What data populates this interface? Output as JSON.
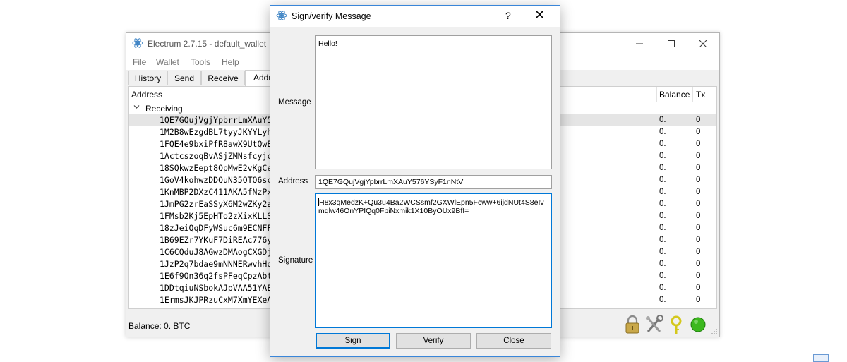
{
  "main_window": {
    "title": "Electrum 2.7.15  -  default_wallet",
    "menu": [
      "File",
      "Wallet",
      "Tools",
      "Help"
    ],
    "tabs": [
      "History",
      "Send",
      "Receive",
      "Addr"
    ],
    "columns": {
      "address": "Address",
      "balance": "Balance",
      "tx": "Tx"
    },
    "group": "Receiving",
    "rows": [
      {
        "address": "1QE7GQujVgjYpbrrLmXAuY5",
        "balance": "0.",
        "tx": "0"
      },
      {
        "address": "1M2B8wEzgdBL7tyyJKYYLyh",
        "balance": "0.",
        "tx": "0"
      },
      {
        "address": "1FQE4e9bxiPfR8awX9UtQwE",
        "balance": "0.",
        "tx": "0"
      },
      {
        "address": "1ActcszoqBvASjZMNsfcyjc",
        "balance": "0.",
        "tx": "0"
      },
      {
        "address": "18SQkwzEept8QpMwE2vKgCe",
        "balance": "0.",
        "tx": "0"
      },
      {
        "address": "1GoV4kohwzDDQuN35QTQ6sc",
        "balance": "0.",
        "tx": "0"
      },
      {
        "address": "1KnMBP2DXzC411AKA5fNzPx",
        "balance": "0.",
        "tx": "0"
      },
      {
        "address": "1JmPG2zrEaSSyX6M2wZKy2a",
        "balance": "0.",
        "tx": "0"
      },
      {
        "address": "1FMsb2Kj5EpHTo2zXixKLLS",
        "balance": "0.",
        "tx": "0"
      },
      {
        "address": "18zJeiQqDFyWSuc6m9ECNFF",
        "balance": "0.",
        "tx": "0"
      },
      {
        "address": "1B69EZr7YKuF7DiREAc776y",
        "balance": "0.",
        "tx": "0"
      },
      {
        "address": "1C6CQduJ8AGwzDMAogCXGDj",
        "balance": "0.",
        "tx": "0"
      },
      {
        "address": "1JzP2q7bdae9mNNNERwvhHq",
        "balance": "0.",
        "tx": "0"
      },
      {
        "address": "1E6f9Qn36q2fsPFeqCpzAbt",
        "balance": "0.",
        "tx": "0"
      },
      {
        "address": "1DDtqiuNSbokAJpVAA51YAE",
        "balance": "0.",
        "tx": "0"
      },
      {
        "address": "1ErmsJKJPRzuCxM7XmYEXeA",
        "balance": "0.",
        "tx": "0"
      }
    ],
    "status_balance": "Balance: 0. BTC",
    "status_icons": [
      "padlock-icon",
      "preferences-icon",
      "seed-icon",
      "network-status-icon"
    ]
  },
  "dialog": {
    "title": "Sign/verify Message",
    "help": "?",
    "close": "✕",
    "labels": {
      "message": "Message",
      "address": "Address",
      "signature": "Signature"
    },
    "message": "Hello!",
    "address": "1QE7GQujVgjYpbrrLmXAuY576YSyF1nNtV",
    "signature_line1": "H8x3qMedzK+Qu3u4Ba2WCSsmf2GXWlEpn5Fcww+6ijdNUt4S8eIv",
    "signature_line2": "mqlw46OnYPIQq0FbiNxmik1X10ByOUx9BfI=",
    "buttons": {
      "sign": "Sign",
      "verify": "Verify",
      "close": "Close"
    }
  },
  "colors": {
    "accent": "#0078d7",
    "dialog_border": "#3a86d9",
    "selected_row": "#e5e5e5"
  }
}
